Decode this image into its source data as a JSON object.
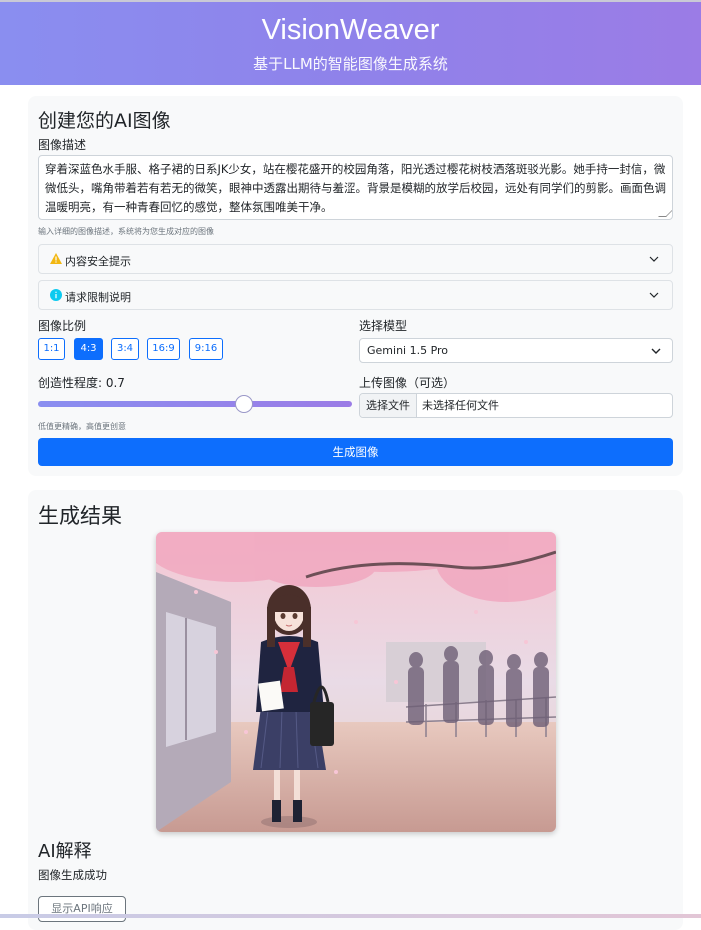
{
  "app": {
    "title": "VisionWeaver",
    "subtitle": "基于LLM的智能图像生成系统"
  },
  "create": {
    "heading": "创建您的AI图像",
    "description_label": "图像描述",
    "description_value": "穿着深蓝色水手服、格子裙的日系JK少女，站在樱花盛开的校园角落，阳光透过樱花树枝洒落斑驳光影。她手持一封信，微微低头，嘴角带着若有若无的微笑，眼神中透露出期待与羞涩。背景是模糊的放学后校园，远处有同学们的剪影。画面色调温暖明亮，有一种青春回忆的感觉，整体氛围唯美干净。",
    "description_hint": "输入详细的图像描述，系统将为您生成对应的图像",
    "safety_notice": "内容安全提示",
    "rate_limit_notice": "请求限制说明",
    "ratio_label": "图像比例",
    "ratios": [
      "1:1",
      "4:3",
      "3:4",
      "16:9",
      "9:16"
    ],
    "selected_ratio": "4:3",
    "model_label": "选择模型",
    "model_value": "Gemini 1.5 Pro",
    "creativity_label": "创造性程度: 0.7",
    "creativity_value": 0.7,
    "creativity_hint": "低值更精确，高值更创意",
    "upload_label": "上传图像（可选）",
    "upload_button": "选择文件",
    "upload_status": "未选择任何文件",
    "generate_button": "生成图像"
  },
  "result": {
    "heading": "生成结果",
    "ai_heading": "AI解释",
    "ai_text": "图像生成成功",
    "show_api_button": "显示API响应"
  },
  "colors": {
    "primary": "#0d6efd",
    "header_start": "#8a8ef0",
    "header_end": "#9b7ce6",
    "warning": "#f2b711",
    "info": "#0dcaf0"
  }
}
